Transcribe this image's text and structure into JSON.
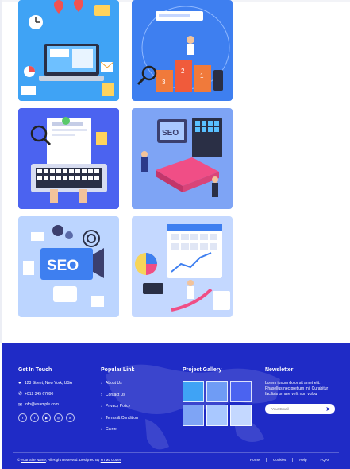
{
  "footer": {
    "contact": {
      "title": "Get In Touch",
      "address": "123 Street, New York, USA",
      "phone": "+012 345 67890",
      "email": "info@example.com"
    },
    "social": [
      "twitter-icon",
      "facebook-icon",
      "youtube-icon",
      "instagram-icon",
      "linkedin-icon"
    ],
    "popular": {
      "title": "Popular Link",
      "links": [
        "About Us",
        "Contact Us",
        "Privacy Policy",
        "Terms & Condition",
        "Career"
      ]
    },
    "gallery": {
      "title": "Project Gallery"
    },
    "newsletter": {
      "title": "Newsletter",
      "text": "Lorem ipsum dolor sit amet elit. Phasellus nec pretium mi. Curabitur facilisis ornare velit non vulpu",
      "placeholder": "Your Email"
    },
    "copyright": {
      "prefix": "©",
      "site": "Your Site Name",
      "middle": ", All Right Reserved. Designed By",
      "designer": "HTML Codex"
    },
    "bottom_links": [
      "Home",
      "Cookies",
      "Help",
      "FQAs"
    ]
  },
  "colors": {
    "footer_bg": "#1f2bc6",
    "tile_light": "#8fb5ff",
    "tile_blue": "#4a7bf0"
  }
}
